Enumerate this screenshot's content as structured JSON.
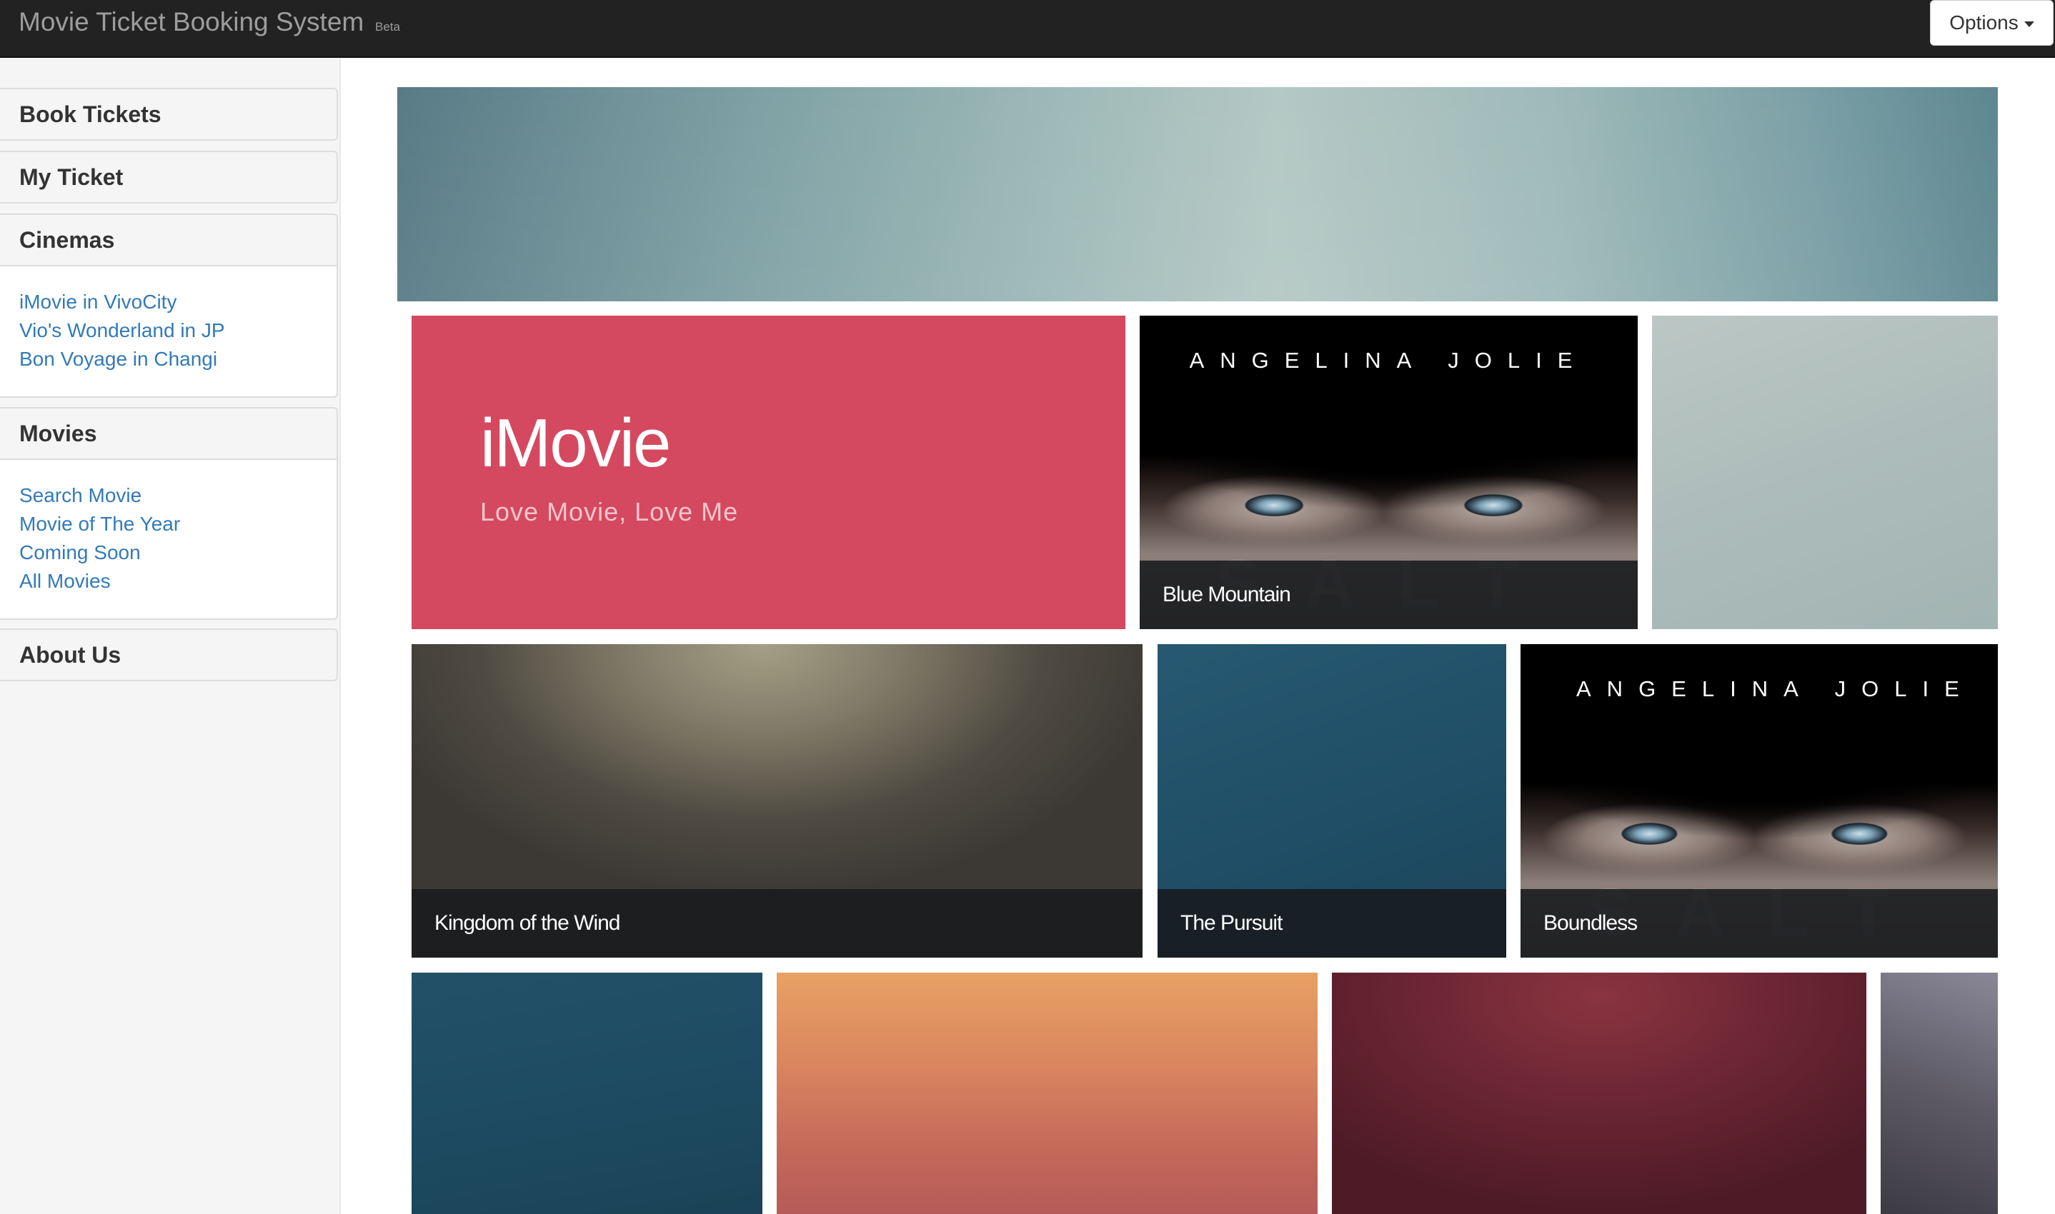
{
  "navbar": {
    "brand": "Movie Ticket Booking System",
    "badge": "Beta",
    "options_label": "Options"
  },
  "sidebar": {
    "book_tickets": "Book Tickets",
    "my_ticket": "My Ticket",
    "cinemas": {
      "heading": "Cinemas",
      "items": [
        "iMovie in VivoCity",
        "Vio's Wonderland in JP",
        "Bon Voyage in Changi"
      ]
    },
    "movies": {
      "heading": "Movies",
      "items": [
        "Search Movie",
        "Movie of The Year",
        "Coming Soon",
        "All Movies"
      ]
    },
    "about_us": "About Us"
  },
  "main": {
    "brand_tile": {
      "title": "iMovie",
      "subtitle": "Love Movie, Love Me"
    },
    "tiles": [
      {
        "caption": "Blue Mountain",
        "poster_credit": "ANGELINA JOLIE",
        "poster_title": "SALT"
      },
      {
        "caption": "Kingdom of the Wind"
      },
      {
        "caption": "The Pursuit"
      },
      {
        "caption": "Boundless",
        "poster_credit": "ANGELINA JOLIE",
        "poster_title": "SALT"
      }
    ]
  },
  "colors": {
    "navbar_bg": "#222222",
    "link": "#337ab7",
    "brand_tile": "#d4495f"
  }
}
